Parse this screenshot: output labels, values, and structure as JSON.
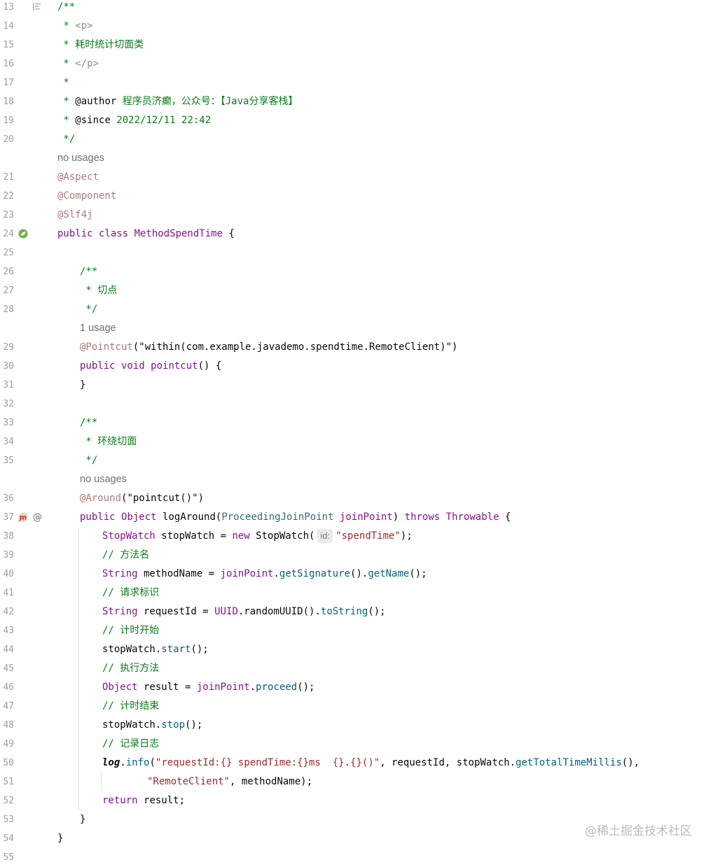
{
  "editor": {
    "lines": [
      {
        "num": "13",
        "indent": 0,
        "tokens": [
          {
            "c": "t-cmt",
            "t": "/**"
          }
        ],
        "fold": true
      },
      {
        "num": "14",
        "indent": 0,
        "tokens": [
          {
            "c": "t-cmt",
            "t": " * "
          },
          {
            "c": "t-tag",
            "t": "<p>"
          }
        ]
      },
      {
        "num": "15",
        "indent": 0,
        "tokens": [
          {
            "c": "t-cmt",
            "t": " * 耗时统计切面类"
          }
        ]
      },
      {
        "num": "16",
        "indent": 0,
        "tokens": [
          {
            "c": "t-cmt",
            "t": " * "
          },
          {
            "c": "t-tag",
            "t": "</p>"
          }
        ]
      },
      {
        "num": "17",
        "indent": 0,
        "tokens": [
          {
            "c": "t-cmt",
            "t": " *"
          }
        ]
      },
      {
        "num": "18",
        "indent": 0,
        "tokens": [
          {
            "c": "t-cmt",
            "t": " * "
          },
          {
            "c": "t-plain",
            "t": "@author"
          },
          {
            "c": "t-cmt",
            "t": " 程序员济癫，公众号：【Java分享客栈】"
          }
        ]
      },
      {
        "num": "19",
        "indent": 0,
        "tokens": [
          {
            "c": "t-cmt",
            "t": " * "
          },
          {
            "c": "t-plain",
            "t": "@since"
          },
          {
            "c": "t-cmt",
            "t": " 2022/12/11 22:42"
          }
        ]
      },
      {
        "num": "20",
        "indent": 0,
        "tokens": [
          {
            "c": "t-cmt",
            "t": " */"
          }
        ]
      },
      {
        "num": "",
        "indent": 0,
        "inlay": "no usages"
      },
      {
        "num": "21",
        "indent": 0,
        "tokens": [
          {
            "c": "t-ann2",
            "t": "@Aspect"
          }
        ]
      },
      {
        "num": "22",
        "indent": 0,
        "tokens": [
          {
            "c": "t-ann2",
            "t": "@Component"
          }
        ]
      },
      {
        "num": "23",
        "indent": 0,
        "tokens": [
          {
            "c": "t-ann2",
            "t": "@Slf4j"
          }
        ]
      },
      {
        "num": "24",
        "indent": 0,
        "gutter": "bean",
        "tokens": [
          {
            "c": "t-kw2",
            "t": "public class "
          },
          {
            "c": "t-kw2",
            "t": "MethodSpendTime"
          },
          {
            "c": "t-plain",
            "t": " {"
          }
        ]
      },
      {
        "num": "25",
        "indent": 0,
        "tokens": []
      },
      {
        "num": "26",
        "indent": 1,
        "tokens": [
          {
            "c": "t-cmt",
            "t": "/**"
          }
        ]
      },
      {
        "num": "27",
        "indent": 1,
        "tokens": [
          {
            "c": "t-cmt",
            "t": " * 切点"
          }
        ]
      },
      {
        "num": "28",
        "indent": 1,
        "tokens": [
          {
            "c": "t-cmt",
            "t": " */"
          }
        ]
      },
      {
        "num": "",
        "indent": 1,
        "inlay": "1 usage"
      },
      {
        "num": "29",
        "indent": 1,
        "tokens": [
          {
            "c": "t-ann2",
            "t": "@Pointcut"
          },
          {
            "c": "t-plain",
            "t": "(\"within(com.example.javademo.spendtime.RemoteClient)\")"
          }
        ]
      },
      {
        "num": "30",
        "indent": 1,
        "tokens": [
          {
            "c": "t-kw2",
            "t": "public void "
          },
          {
            "c": "t-kw2",
            "t": "pointcut"
          },
          {
            "c": "t-plain",
            "t": "() {"
          }
        ]
      },
      {
        "num": "31",
        "indent": 1,
        "tokens": [
          {
            "c": "t-plain",
            "t": "}"
          }
        ]
      },
      {
        "num": "32",
        "indent": 0,
        "tokens": []
      },
      {
        "num": "33",
        "indent": 1,
        "tokens": [
          {
            "c": "t-cmt",
            "t": "/**"
          }
        ]
      },
      {
        "num": "34",
        "indent": 1,
        "tokens": [
          {
            "c": "t-cmt",
            "t": " * 环绕切面"
          }
        ]
      },
      {
        "num": "35",
        "indent": 1,
        "tokens": [
          {
            "c": "t-cmt",
            "t": " */"
          }
        ]
      },
      {
        "num": "",
        "indent": 1,
        "inlay": "no usages"
      },
      {
        "num": "36",
        "indent": 1,
        "tokens": [
          {
            "c": "t-ann2",
            "t": "@Around"
          },
          {
            "c": "t-plain",
            "t": "(\"pointcut()\")"
          }
        ]
      },
      {
        "num": "37",
        "indent": 1,
        "gutter": "method",
        "tokens": [
          {
            "c": "t-kw2",
            "t": "public "
          },
          {
            "c": "t-kw2",
            "t": "Object "
          },
          {
            "c": "t-plain",
            "t": "logAround("
          },
          {
            "c": "t-param",
            "t": "ProceedingJoinPoint"
          },
          {
            "c": "t-plain",
            "t": " "
          },
          {
            "c": "t-kw2",
            "t": "joinPoint"
          },
          {
            "c": "t-plain",
            "t": ") "
          },
          {
            "c": "t-kw2",
            "t": "throws "
          },
          {
            "c": "t-kw2",
            "t": "Throwable"
          },
          {
            "c": "t-plain",
            "t": " {"
          }
        ]
      },
      {
        "num": "38",
        "indent": 2,
        "tokens": [
          {
            "c": "t-kw2",
            "t": "StopWatch"
          },
          {
            "c": "t-plain",
            "t": " stopWatch = "
          },
          {
            "c": "t-kw2",
            "t": "new "
          },
          {
            "c": "t-plain",
            "t": "StopWatch("
          },
          {
            "c": "hint",
            "t": "id:"
          },
          {
            "c": "t-str2",
            "t": "\"spendTime\""
          },
          {
            "c": "t-plain",
            "t": ");"
          }
        ]
      },
      {
        "num": "39",
        "indent": 2,
        "tokens": [
          {
            "c": "t-cmt",
            "t": "// 方法名"
          }
        ]
      },
      {
        "num": "40",
        "indent": 2,
        "tokens": [
          {
            "c": "t-kw2",
            "t": "String"
          },
          {
            "c": "t-plain",
            "t": " methodName = "
          },
          {
            "c": "t-kw2",
            "t": "joinPoint"
          },
          {
            "c": "t-plain",
            "t": "."
          },
          {
            "c": "t-method",
            "t": "getSignature"
          },
          {
            "c": "t-plain",
            "t": "()."
          },
          {
            "c": "t-method",
            "t": "getName"
          },
          {
            "c": "t-plain",
            "t": "();"
          }
        ]
      },
      {
        "num": "41",
        "indent": 2,
        "tokens": [
          {
            "c": "t-cmt",
            "t": "// 请求标识"
          }
        ]
      },
      {
        "num": "42",
        "indent": 2,
        "tokens": [
          {
            "c": "t-kw2",
            "t": "String"
          },
          {
            "c": "t-plain",
            "t": " requestId = "
          },
          {
            "c": "t-kw2",
            "t": "UUID"
          },
          {
            "c": "t-plain",
            "t": ".randomUUID()."
          },
          {
            "c": "t-method",
            "t": "toString"
          },
          {
            "c": "t-plain",
            "t": "();"
          }
        ]
      },
      {
        "num": "43",
        "indent": 2,
        "tokens": [
          {
            "c": "t-cmt",
            "t": "// 计时开始"
          }
        ]
      },
      {
        "num": "44",
        "indent": 2,
        "tokens": [
          {
            "c": "t-plain",
            "t": "stopWatch."
          },
          {
            "c": "t-method",
            "t": "start"
          },
          {
            "c": "t-plain",
            "t": "();"
          }
        ]
      },
      {
        "num": "45",
        "indent": 2,
        "tokens": [
          {
            "c": "t-cmt",
            "t": "// 执行方法"
          }
        ]
      },
      {
        "num": "46",
        "indent": 2,
        "tokens": [
          {
            "c": "t-kw2",
            "t": "Object"
          },
          {
            "c": "t-plain",
            "t": " result = "
          },
          {
            "c": "t-kw2",
            "t": "joinPoint"
          },
          {
            "c": "t-plain",
            "t": "."
          },
          {
            "c": "t-method",
            "t": "proceed"
          },
          {
            "c": "t-plain",
            "t": "();"
          }
        ]
      },
      {
        "num": "47",
        "indent": 2,
        "tokens": [
          {
            "c": "t-cmt",
            "t": "// 计时结束"
          }
        ]
      },
      {
        "num": "48",
        "indent": 2,
        "tokens": [
          {
            "c": "t-plain",
            "t": "stopWatch."
          },
          {
            "c": "t-method",
            "t": "stop"
          },
          {
            "c": "t-plain",
            "t": "();"
          }
        ]
      },
      {
        "num": "49",
        "indent": 2,
        "tokens": [
          {
            "c": "t-cmt",
            "t": "// 记录日志"
          }
        ]
      },
      {
        "num": "50",
        "indent": 2,
        "tokens": [
          {
            "c": "t-static",
            "t": "log"
          },
          {
            "c": "t-plain",
            "t": "."
          },
          {
            "c": "t-method",
            "t": "info"
          },
          {
            "c": "t-plain",
            "t": "("
          },
          {
            "c": "t-str2",
            "t": "\"requestId:{} spendTime:{}ms  {}.{}()\""
          },
          {
            "c": "t-plain",
            "t": ", requestId, stopWatch."
          },
          {
            "c": "t-method",
            "t": "getTotalTimeMillis"
          },
          {
            "c": "t-plain",
            "t": "(),"
          }
        ]
      },
      {
        "num": "51",
        "indent": 4,
        "tokens": [
          {
            "c": "t-str2",
            "t": "\"RemoteClient\""
          },
          {
            "c": "t-plain",
            "t": ", methodName);"
          }
        ]
      },
      {
        "num": "52",
        "indent": 2,
        "tokens": [
          {
            "c": "t-kw2",
            "t": "return "
          },
          {
            "c": "t-plain",
            "t": "result;"
          }
        ]
      },
      {
        "num": "53",
        "indent": 1,
        "tokens": [
          {
            "c": "t-plain",
            "t": "}"
          }
        ]
      },
      {
        "num": "54",
        "indent": 0,
        "tokens": [
          {
            "c": "t-plain",
            "t": "}"
          }
        ]
      },
      {
        "num": "55",
        "indent": 0,
        "tokens": []
      }
    ]
  },
  "gutter_icons": {
    "fold": "fold-marker-icon",
    "bean": "spring-bean-icon",
    "method": "aspect-method-icon",
    "at": "@"
  },
  "watermark": "@稀土掘金技术社区"
}
